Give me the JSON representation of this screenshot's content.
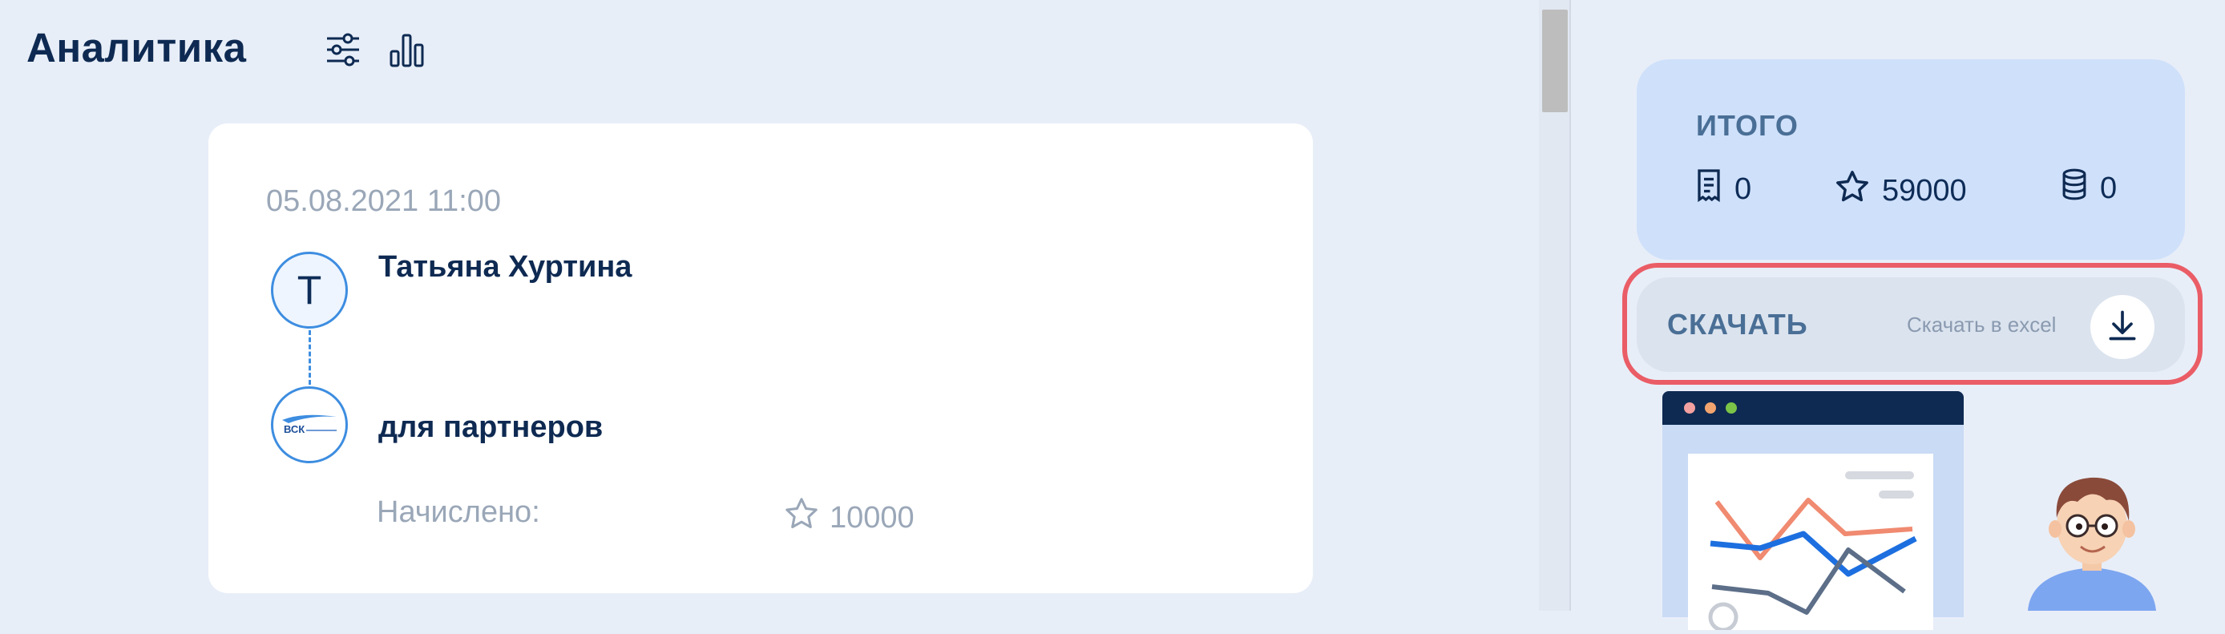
{
  "header": {
    "title": "Аналитика",
    "icons": [
      "sliders-icon",
      "bar-chart-icon"
    ]
  },
  "card": {
    "date": "05.08.2021 11:00",
    "avatar_letter": "Т",
    "user_name": "Татьяна Хуртина",
    "partner_logo_text": "ВСК",
    "partner_label": "для партнеров",
    "accrued_label": "Начислено:",
    "accrued_value": "10000"
  },
  "totals": {
    "title": "ИТОГО",
    "receipts": "0",
    "stars": "59000",
    "coins": "0"
  },
  "download": {
    "label": "СКАЧАТЬ",
    "hint": "Скачать в excel"
  },
  "colors": {
    "background": "#e8eef8",
    "card": "#ffffff",
    "accent_blue": "#3d8de0",
    "totals_bg": "#cfe0fa",
    "download_bg": "#dbe3ee",
    "highlight": "#ea5d66",
    "dark_navy": "#0e2a52"
  }
}
